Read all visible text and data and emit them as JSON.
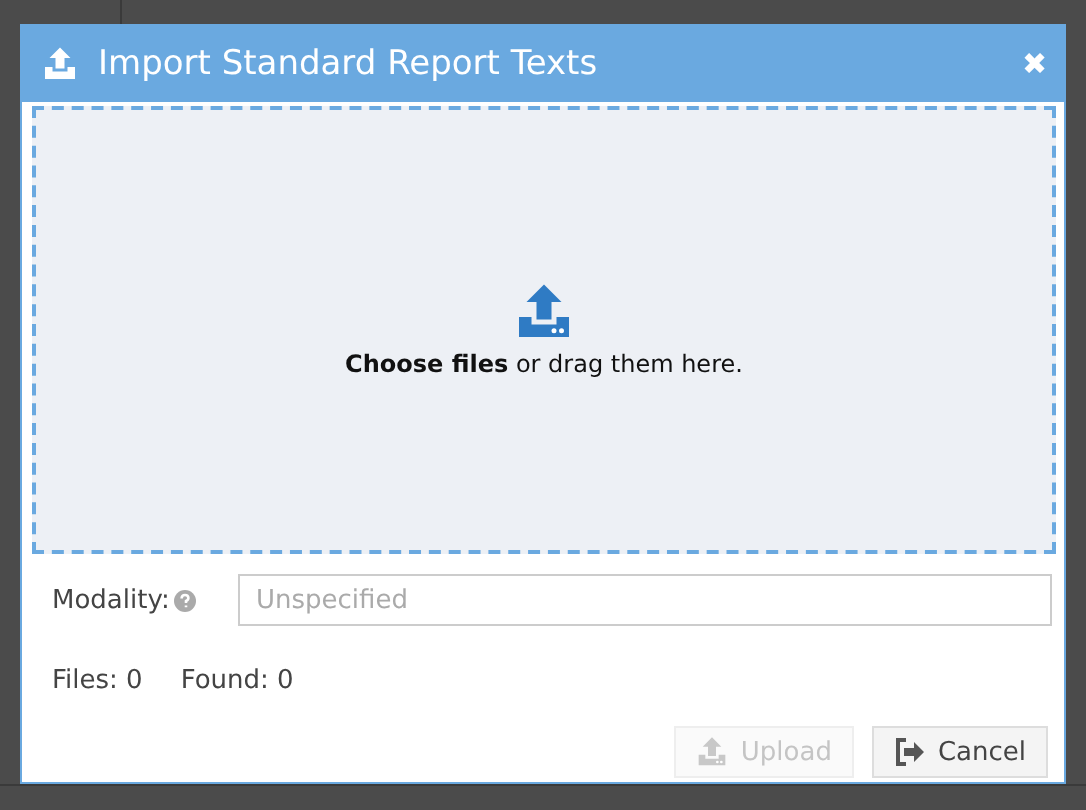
{
  "dialog": {
    "title": "Import Standard Report Texts",
    "close": "✖",
    "dropzone": {
      "text": "**Choose files** or drag them here."
    },
    "modality": {
      "label": "Modality:",
      "placeholder": "Unspecified"
    },
    "counts": [
      "Files: 0",
      "Found: 0"
    ],
    "buttons": [
      {
        "kind": "upload",
        "label": "Upload",
        "disabled": true
      },
      {
        "kind": "cancel",
        "label": "Cancel",
        "disabled": false
      }
    ]
  }
}
